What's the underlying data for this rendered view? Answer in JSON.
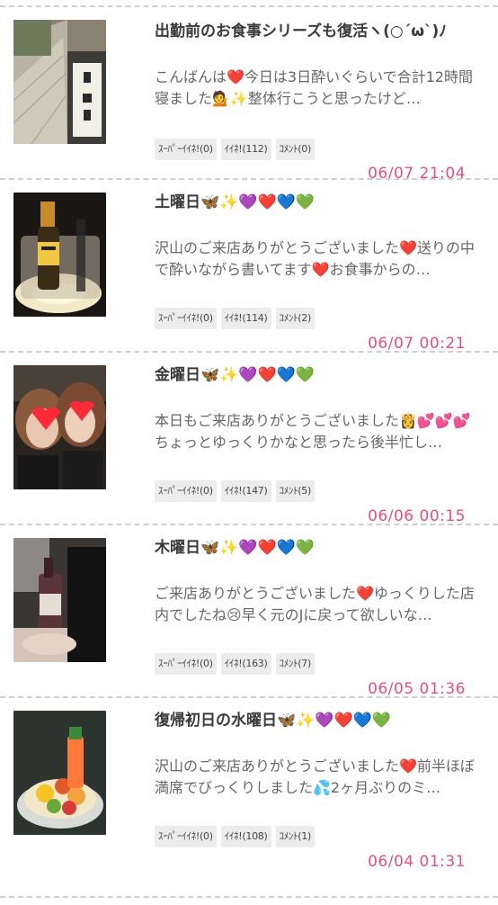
{
  "posts": [
    {
      "title": "出勤前のお食事シリーズも復活ヽ(○´ω`)ﾉ",
      "excerpt": "こんばんは❤️今日は3日酔いぐらいで合計12時間寝ました💁✨整体行こうと思ったけど…",
      "tags": [
        "ｽｰﾊﾟｰｲｲﾈ!(0)",
        "ｲｲﾈ!(112)",
        "ｺﾒﾝﾄ(0)"
      ],
      "date": "06/07 21:04",
      "thumb": "street-photo"
    },
    {
      "title": "土曜日🦋✨💜❤️💙💚",
      "excerpt": "沢山のご来店ありがとうございました❤️送りの中で酔いながら書いてます❤️お食事からの…",
      "tags": [
        "ｽｰﾊﾟｰｲｲﾈ!(0)",
        "ｲｲﾈ!(114)",
        "ｺﾒﾝﾄ(2)"
      ],
      "date": "06/07 00:21",
      "thumb": "champagne-photo"
    },
    {
      "title": "金曜日🦋✨💜❤️💙💚",
      "excerpt": "本日もご来店ありがとうございました👸💕💕💕ちょっとゆっくりかなと思ったら後半忙し…",
      "tags": [
        "ｽｰﾊﾟｰｲｲﾈ!(0)",
        "ｲｲﾈ!(147)",
        "ｺﾒﾝﾄ(5)"
      ],
      "date": "06/06 00:15",
      "thumb": "selfie-photo"
    },
    {
      "title": "木曜日🦋✨💜❤️💙💚",
      "excerpt": "ご来店ありがとうございました❤️ゆっくりした店内でしたね😢早く元のJに戻って欲しいな…",
      "tags": [
        "ｽｰﾊﾟｰｲｲﾈ!(0)",
        "ｲｲﾈ!(163)",
        "ｺﾒﾝﾄ(7)"
      ],
      "date": "06/05 01:36",
      "thumb": "wine-photo"
    },
    {
      "title": "復帰初日の水曜日🦋✨💜❤️💙💚",
      "excerpt": "沢山のご来店ありがとうございました❤️前半ほぼ満席でびっくりしました💦2ヶ月ぶりのミ…",
      "tags": [
        "ｽｰﾊﾟｰｲｲﾈ!(0)",
        "ｲｲﾈ!(108)",
        "ｺﾒﾝﾄ(1)"
      ],
      "date": "06/04 01:31",
      "thumb": "fruit-photo"
    }
  ]
}
